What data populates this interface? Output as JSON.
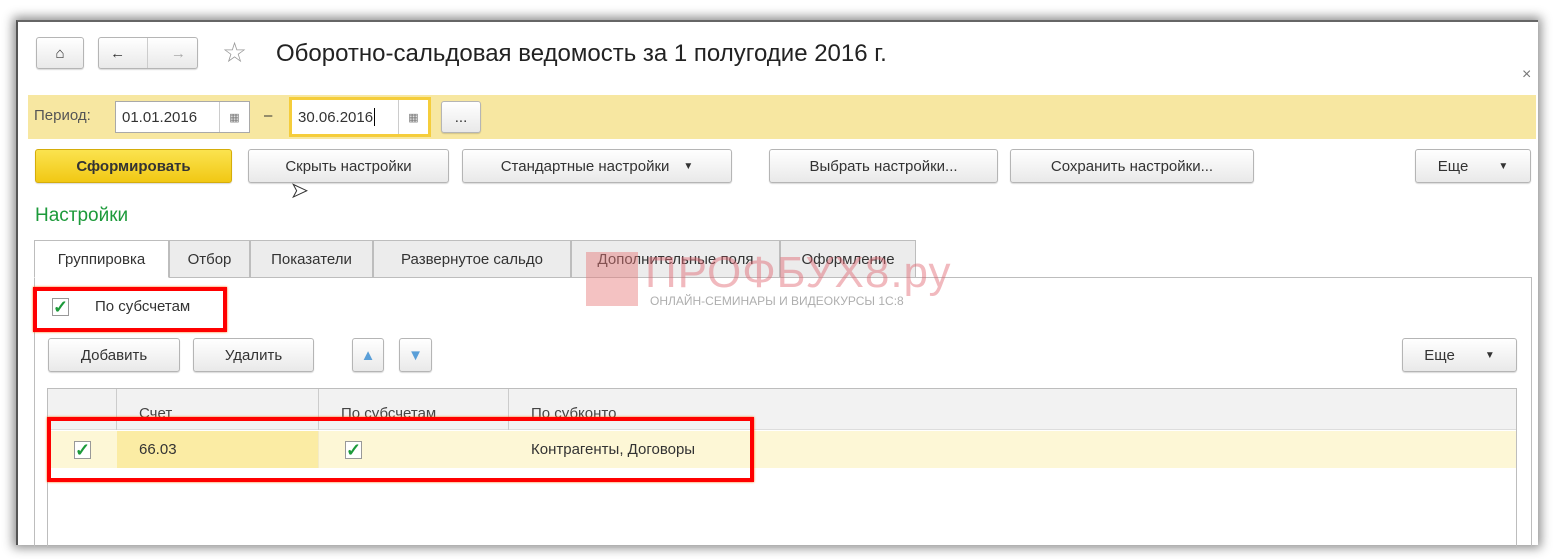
{
  "title": "Оборотно-сальдовая ведомость за 1 полугодие 2016 г.",
  "close": "×",
  "period": {
    "label": "Период:",
    "from": "01.01.2016",
    "to": "30.06.2016",
    "dash": "–",
    "more": "..."
  },
  "toolbar": {
    "generate": "Сформировать",
    "hide_settings": "Скрыть настройки",
    "standard_settings": "Стандартные настройки",
    "choose_settings": "Выбрать настройки...",
    "save_settings": "Сохранить настройки...",
    "more": "Еще"
  },
  "settings_heading": "Настройки",
  "tabs": [
    "Группировка",
    "Отбор",
    "Показатели",
    "Развернутое сальдо",
    "Дополнительные поля",
    "Оформление"
  ],
  "by_subaccounts": {
    "label": "По субсчетам",
    "checked": true
  },
  "grid_toolbar": {
    "add": "Добавить",
    "delete": "Удалить",
    "more": "Еще"
  },
  "table": {
    "columns": [
      "Счет",
      "По субсчетам",
      "По субконто"
    ],
    "rows": [
      {
        "checked": true,
        "account": "66.03",
        "by_subaccounts": true,
        "by_subconto": "Контрагенты, Договоры"
      }
    ]
  },
  "watermark": {
    "brand": "ПРОФБУХ8.ру",
    "tagline": "ОНЛАЙН-СЕМИНАРЫ И ВИДЕОКУРСЫ 1С:8"
  },
  "colors": {
    "accent_yellow": "#f7e7a1",
    "green": "#1c9a3a",
    "highlight": "#ff0000"
  }
}
